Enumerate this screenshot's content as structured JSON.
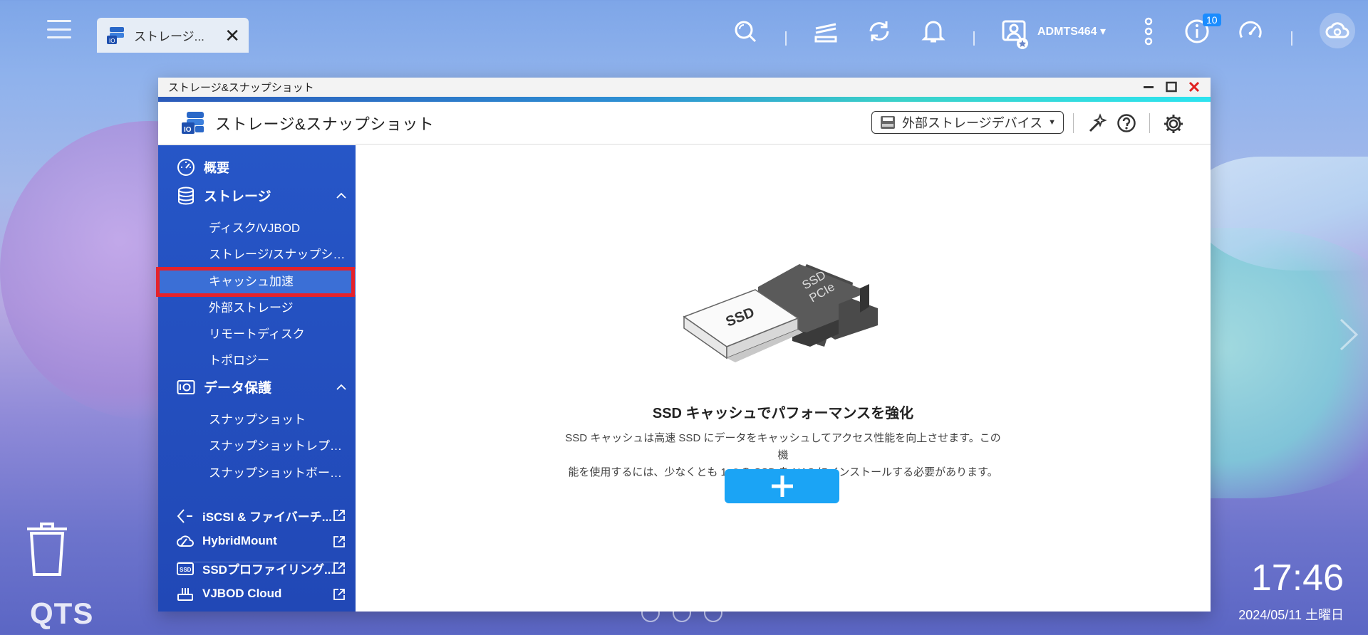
{
  "taskbar": {
    "tab_label": "ストレージ...",
    "user_name": "ADMTS464",
    "notification_count": "10"
  },
  "desktop": {
    "logo": "QTS",
    "time": "17:46",
    "date": "2024/05/11 土曜日"
  },
  "window": {
    "titlebar": "ストレージ&スナップショット",
    "app_title": "ストレージ&スナップショット",
    "device_select": "外部ストレージデバイス"
  },
  "sidebar": {
    "overview": "概要",
    "storage": "ストレージ",
    "storage_items": [
      "ディスク/VJBOD",
      "ストレージ/スナップショ...",
      "キャッシュ加速",
      "外部ストレージ",
      "リモートディスク",
      "トポロジー"
    ],
    "data_protection": "データ保護",
    "protection_items": [
      "スナップショット",
      "スナップショットレプリカ",
      "スナップショットボールト"
    ],
    "links": [
      "iSCSI & ファイバーチ...",
      "HybridMount",
      "SSDプロファイリング...",
      "VJBOD Cloud"
    ],
    "active_item": "キャッシュ加速"
  },
  "main": {
    "illustration": {
      "ssd_label": "SSD",
      "pcie_label_1": "SSD",
      "pcie_label_2": "PCIe"
    },
    "title": "SSD キャッシュでパフォーマンスを強化",
    "description_line1": "SSD キャッシュは高速 SSD にデータをキャッシュしてアクセス性能を向上させます。この機",
    "description_line2": "能を使用するには、少なくとも 1 つの SSD を NAS にインストールする必要があります。",
    "add_button_label": "+"
  },
  "colors": {
    "sidebar": "#2656c7",
    "active_item": "#3b6fd6",
    "highlight_box": "#e5222b",
    "add_button": "#1ba4f5"
  }
}
